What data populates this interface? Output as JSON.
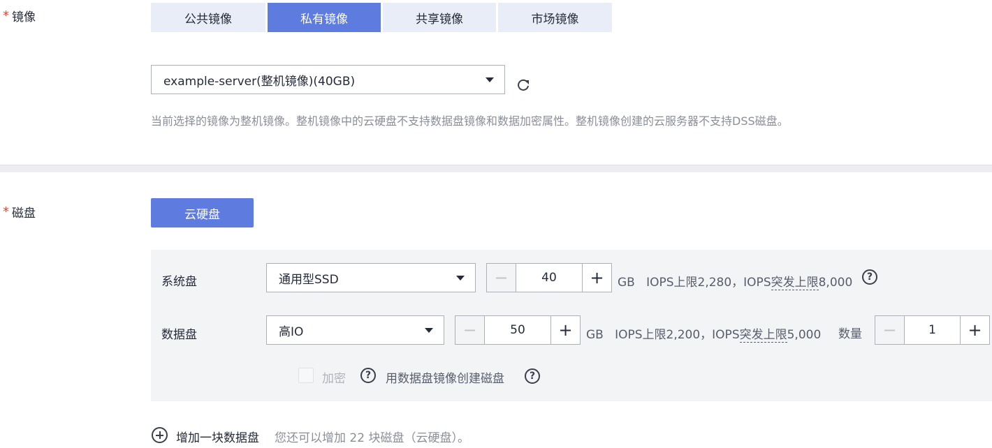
{
  "image": {
    "label": "镜像",
    "required_mark": "*",
    "tabs": [
      {
        "label": "公共镜像",
        "active": false
      },
      {
        "label": "私有镜像",
        "active": true
      },
      {
        "label": "共享镜像",
        "active": false
      },
      {
        "label": "市场镜像",
        "active": false
      }
    ],
    "select_value": "example-server(整机镜像)(40GB)",
    "refresh_icon": "refresh-icon",
    "hint": "当前选择的镜像为整机镜像。整机镜像中的云硬盘不支持数据盘镜像和数据加密属性。整机镜像创建的云服务器不支持DSS磁盘。"
  },
  "disk": {
    "label": "磁盘",
    "required_mark": "*",
    "type_button": "云硬盘",
    "system": {
      "label": "系统盘",
      "type": "通用型SSD",
      "size": "40",
      "unit": "GB",
      "iops_prefix": "IOPS上限2,280，IOPS",
      "iops_burst": "突发上限",
      "iops_suffix": "8,000"
    },
    "data": {
      "label": "数据盘",
      "type": "高IO",
      "size": "50",
      "unit": "GB",
      "iops_prefix": "IOPS上限2,200，IOPS",
      "iops_burst": "突发上限",
      "iops_suffix": "5,000",
      "quantity_label": "数量",
      "quantity": "1"
    },
    "encrypt_label": "加密",
    "create_from_image_label": "用数据盘镜像创建磁盘",
    "add_disk_label": "增加一块数据盘",
    "add_disk_hint": "您还可以增加 22 块磁盘（云硬盘）。"
  },
  "colors": {
    "accent": "#5e7ce0",
    "required": "#e04a3b",
    "panel_bg": "#f3f4f6"
  }
}
